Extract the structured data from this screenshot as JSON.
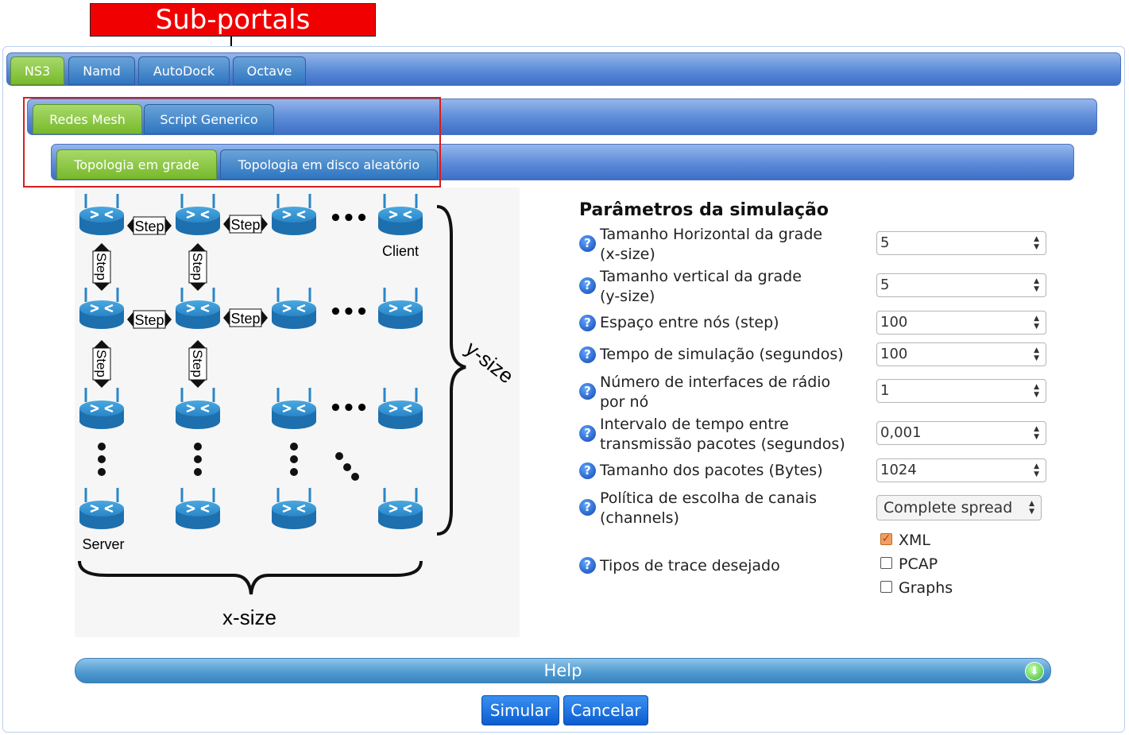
{
  "annotation": {
    "label": "Sub-portals"
  },
  "tabs_level1": [
    {
      "label": "NS3",
      "active": true
    },
    {
      "label": "Namd",
      "active": false
    },
    {
      "label": "AutoDock",
      "active": false
    },
    {
      "label": "Octave",
      "active": false
    }
  ],
  "tabs_level2": [
    {
      "label": "Redes Mesh",
      "active": true
    },
    {
      "label": "Script Generico",
      "active": false
    }
  ],
  "tabs_level3": [
    {
      "label": "Topologia em grade",
      "active": true
    },
    {
      "label": "Topologia em disco aleatório",
      "active": false
    }
  ],
  "illustration": {
    "step_label": "Step",
    "client_label": "Client",
    "server_label": "Server",
    "xsize_label": "x-size",
    "ysize_label": "y-size"
  },
  "params": {
    "title": "Parâmetros da simulação",
    "help_glyph": "?",
    "fields": [
      {
        "label_line1": "Tamanho Horizontal da grade",
        "label_line2": "(x-size)",
        "value": "5"
      },
      {
        "label_line1": "Tamanho vertical da grade",
        "label_line2": "(y-size)",
        "value": "5"
      },
      {
        "label_line1": "Espaço entre nós (step)",
        "label_line2": "",
        "value": "100"
      },
      {
        "label_line1": "Tempo de simulação (segundos)",
        "label_line2": "",
        "value": "100"
      },
      {
        "label_line1": "Número de interfaces de rádio",
        "label_line2": "por nó",
        "value": "1"
      },
      {
        "label_line1": "Intervalo de tempo entre",
        "label_line2": "transmissão pacotes (segundos)",
        "value": "0,001"
      },
      {
        "label_line1": "Tamanho dos pacotes (Bytes)",
        "label_line2": "",
        "value": "1024"
      }
    ],
    "channels": {
      "label_line1": "Política de escolha de canais",
      "label_line2": "(channels)",
      "selected": "Complete spread"
    },
    "trace": {
      "label": "Tipos de trace desejado",
      "options": [
        {
          "label": "XML",
          "checked": true
        },
        {
          "label": "PCAP",
          "checked": false
        },
        {
          "label": "Graphs",
          "checked": false
        }
      ]
    }
  },
  "help": {
    "label": "Help"
  },
  "buttons": {
    "submit": "Simular",
    "cancel": "Cancelar"
  },
  "colors": {
    "tab_active": "#78b92b",
    "tab_inactive": "#2e75c1",
    "button": "#0b5dd0",
    "annotation": "#f00000"
  }
}
